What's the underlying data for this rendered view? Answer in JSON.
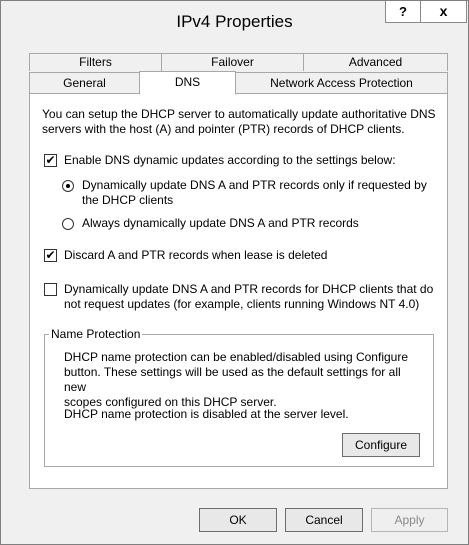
{
  "window": {
    "title": "IPv4 Properties",
    "help_glyph": "?",
    "close_glyph": "x"
  },
  "tabs": [
    {
      "label": "Filters",
      "active": false
    },
    {
      "label": "Failover",
      "active": false
    },
    {
      "label": "Advanced",
      "active": false
    },
    {
      "label": "General",
      "active": false
    },
    {
      "label": "DNS",
      "active": true
    },
    {
      "label": "Network Access Protection",
      "active": false
    }
  ],
  "dns": {
    "intro_line1": "You can setup the DHCP server to automatically update authoritative DNS",
    "intro_line2": "servers with the host (A) and pointer (PTR) records of DHCP clients.",
    "enable_updates": {
      "label": "Enable DNS dynamic updates according to the settings below:",
      "checked": true
    },
    "radio_requested": {
      "line1": "Dynamically update DNS A and PTR records only if requested by",
      "line2": "the DHCP clients",
      "selected": true
    },
    "radio_always": {
      "label": "Always dynamically update DNS A and PTR records",
      "selected": false
    },
    "discard_records": {
      "label": "Discard A and PTR records when lease is deleted",
      "checked": true
    },
    "update_non_requesting": {
      "line1": "Dynamically update DNS A and PTR records for DHCP clients that do",
      "line2": "not request updates (for example, clients running Windows NT 4.0)",
      "checked": false
    },
    "name_protection": {
      "legend": "Name Protection",
      "desc_line1": "DHCP name protection can be enabled/disabled using Configure",
      "desc_line2": "button. These settings will be used as the default settings for all new",
      "desc_line3": "scopes configured on this DHCP server.",
      "status": "DHCP name protection is disabled at the server level.",
      "configure_label": "Configure"
    }
  },
  "footer": {
    "ok_label": "OK",
    "cancel_label": "Cancel",
    "apply_label": "Apply"
  }
}
